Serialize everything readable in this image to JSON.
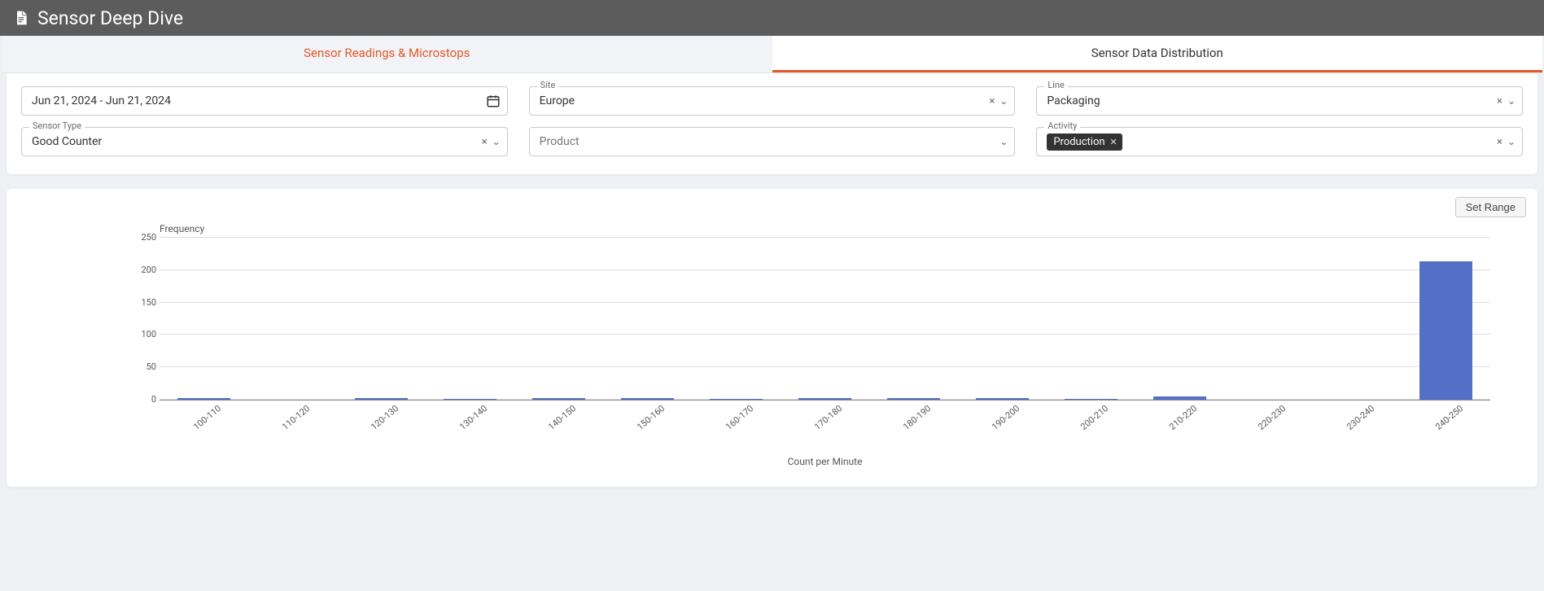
{
  "header": {
    "title": "Sensor Deep Dive"
  },
  "tabs": {
    "left": "Sensor Readings & Microstops",
    "right": "Sensor Data Distribution"
  },
  "filters": {
    "date_range": {
      "value": "Jun 21, 2024 - Jun 21, 2024"
    },
    "site": {
      "label": "Site",
      "value": "Europe"
    },
    "line": {
      "label": "Line",
      "value": "Packaging"
    },
    "sensor_type": {
      "label": "Sensor Type",
      "value": "Good Counter"
    },
    "product": {
      "label": "Product",
      "value": ""
    },
    "activity": {
      "label": "Activity",
      "chip": "Production"
    }
  },
  "buttons": {
    "set_range": "Set Range"
  },
  "chart_data": {
    "type": "bar",
    "title": "",
    "ylabel": "Frequency",
    "xlabel": "Count per Minute",
    "ylim": [
      0,
      250
    ],
    "yticks": [
      0,
      50,
      100,
      150,
      200,
      250
    ],
    "categories": [
      "100-110",
      "110-120",
      "120-130",
      "130-140",
      "140-150",
      "150-160",
      "160-170",
      "170-180",
      "180-190",
      "190-200",
      "200-210",
      "210-220",
      "220-230",
      "230-240",
      "240-250"
    ],
    "values": [
      3,
      0,
      3,
      1,
      2,
      3,
      1,
      2,
      3,
      2,
      1,
      5,
      0,
      0,
      213
    ]
  }
}
